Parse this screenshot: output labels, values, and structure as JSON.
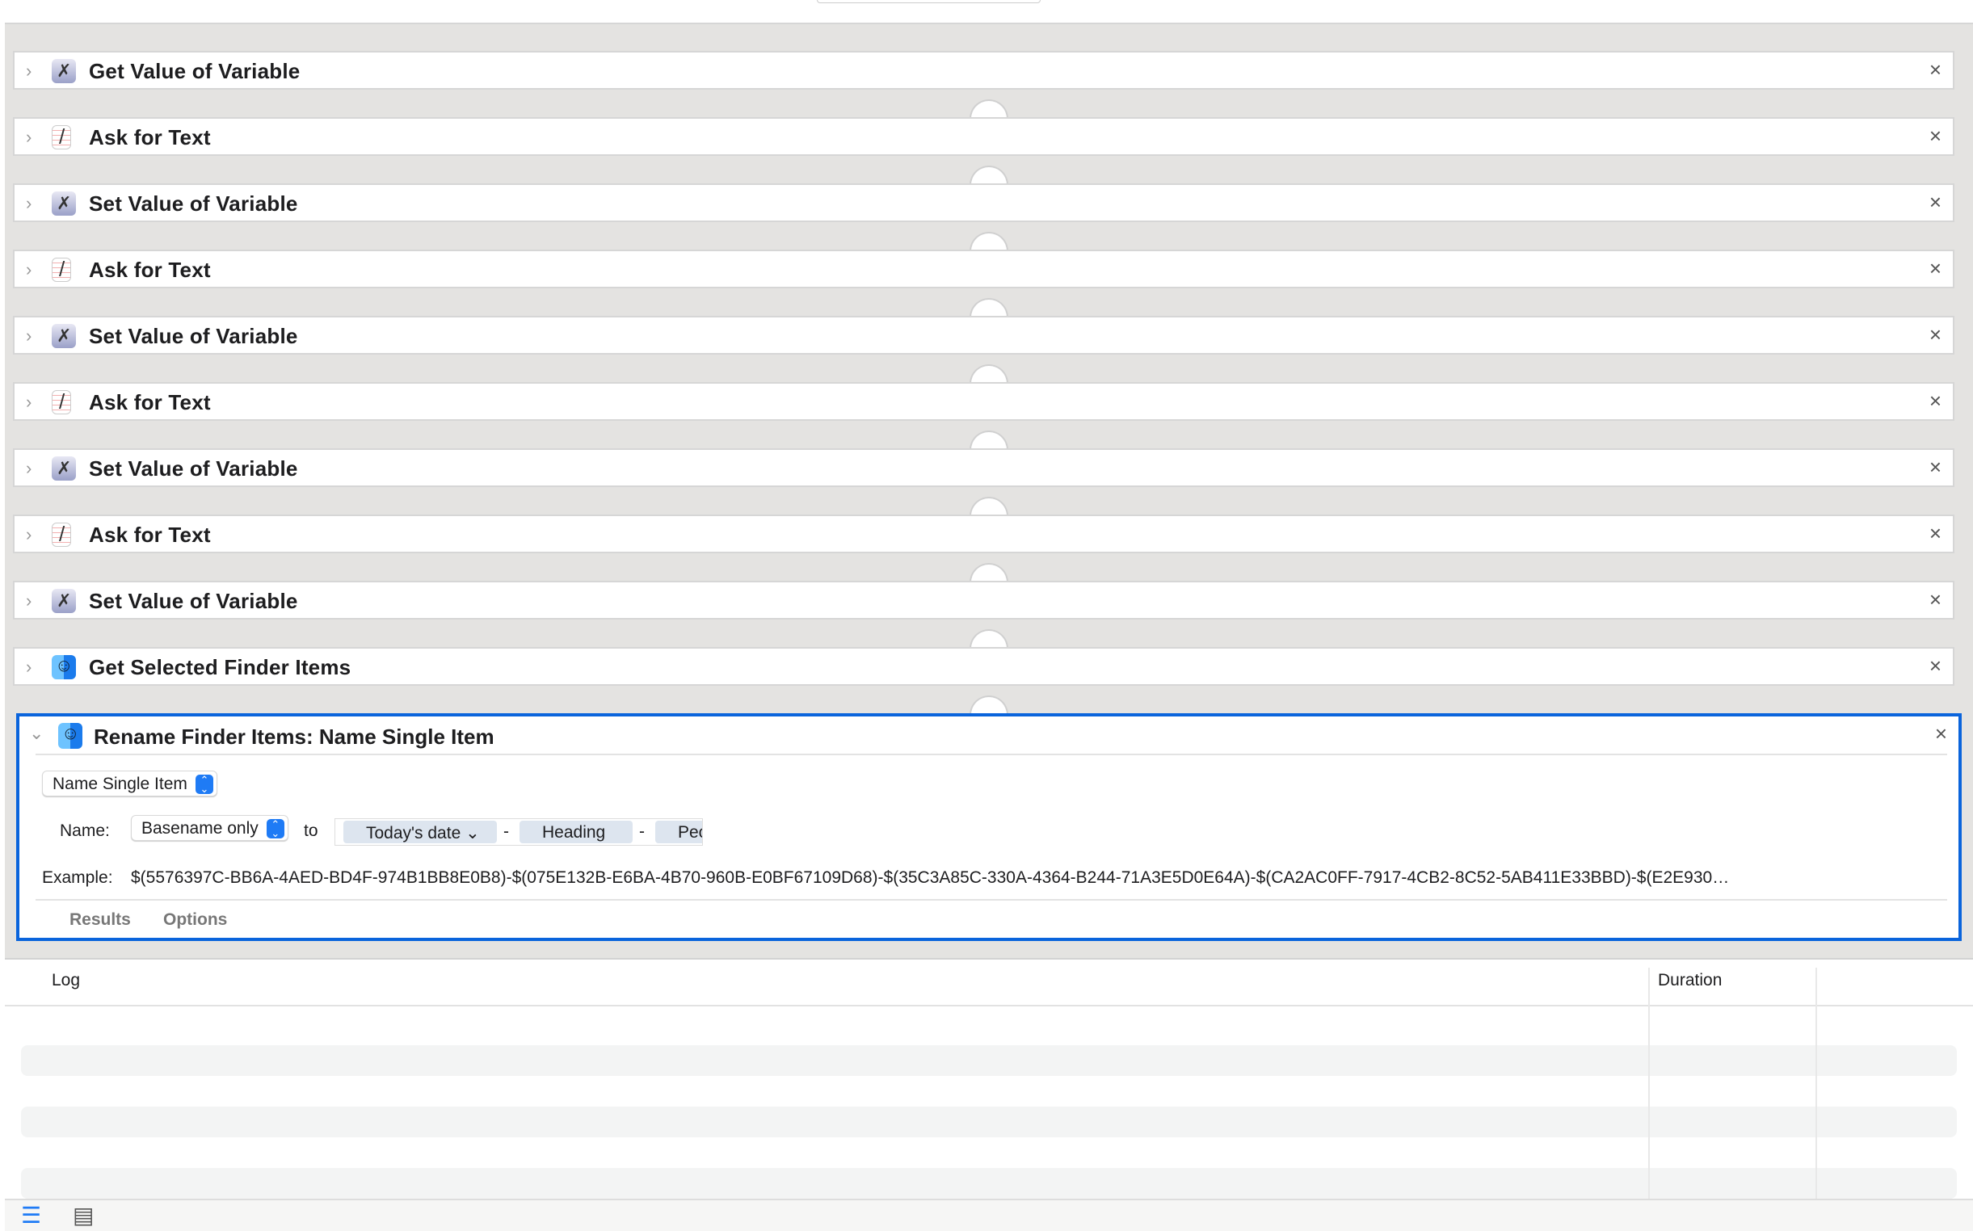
{
  "actions": [
    {
      "title": "Get Value of Variable",
      "icon": "variable-icon"
    },
    {
      "title": "Ask for Text",
      "icon": "text-edit-icon"
    },
    {
      "title": "Set Value of Variable",
      "icon": "variable-icon"
    },
    {
      "title": "Ask for Text",
      "icon": "text-edit-icon"
    },
    {
      "title": "Set Value of Variable",
      "icon": "variable-icon"
    },
    {
      "title": "Ask for Text",
      "icon": "text-edit-icon"
    },
    {
      "title": "Set Value of Variable",
      "icon": "variable-icon"
    },
    {
      "title": "Ask for Text",
      "icon": "text-edit-icon"
    },
    {
      "title": "Set Value of Variable",
      "icon": "variable-icon"
    },
    {
      "title": "Get Selected Finder Items",
      "icon": "finder-icon"
    }
  ],
  "expanded": {
    "title": "Rename Finder Items: Name Single Item",
    "mode": "Name Single Item",
    "name_label": "Name:",
    "name_scope": "Basename only",
    "to_label": "to",
    "tokens": [
      "Today's date",
      "Heading",
      "Pec"
    ],
    "separator": "-",
    "example_label": "Example:",
    "example": "$(5576397C-BB6A-4AED-BD4F-974B1BB8E0B8)-$(075E132B-E6BA-4B70-960B-E0BF67109D68)-$(35C3A85C-330A-4364-B244-71A3E5D0E64A)-$(CA2AC0FF-7917-4CB2-8C52-5AB411E33BBD)-$(E2E930…",
    "tabs": [
      "Results",
      "Options"
    ]
  },
  "log": {
    "columns": [
      "Log",
      "Duration"
    ]
  },
  "colors": {
    "accent": "#0a64dc",
    "canvas": "#e4e3e1"
  }
}
